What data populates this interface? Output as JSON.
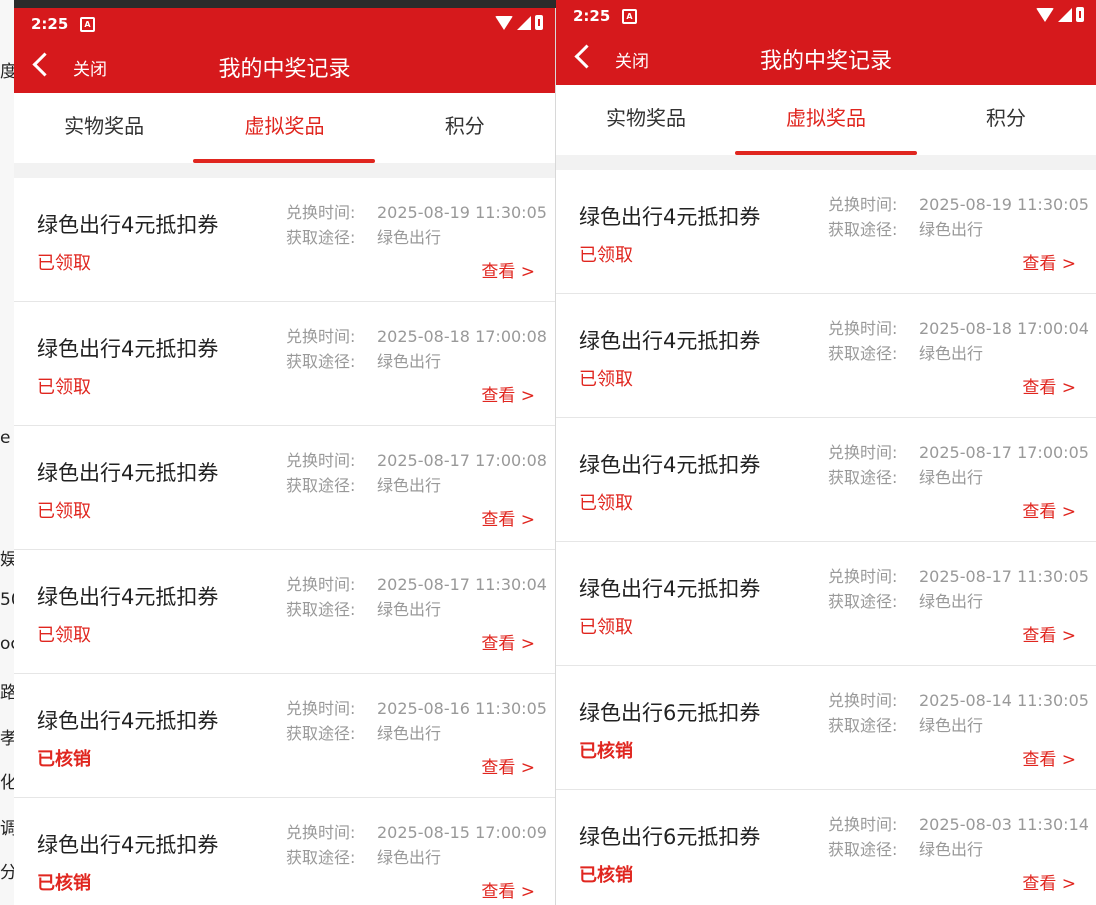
{
  "background_fragments": [
    "度",
    "e C",
    "娱",
    "50",
    "oc",
    "路",
    "孝",
    "化",
    "调",
    "分"
  ],
  "screens": [
    {
      "status": {
        "time": "2:25",
        "notif_icon": "A"
      },
      "nav": {
        "close_label": "关闭",
        "title": "我的中奖记录"
      },
      "tabs": [
        {
          "label": "实物奖品",
          "active": false
        },
        {
          "label": "虚拟奖品",
          "active": true
        },
        {
          "label": "积分",
          "active": false
        }
      ],
      "items": [
        {
          "name": "绿色出行4元抵扣券",
          "status": "已领取",
          "time_label": "兑换时间:",
          "time": "2025-08-19 11:30:05",
          "source_label": "获取途径:",
          "source": "绿色出行",
          "view": "查看 >"
        },
        {
          "name": "绿色出行4元抵扣券",
          "status": "已领取",
          "time_label": "兑换时间:",
          "time": "2025-08-18 17:00:08",
          "source_label": "获取途径:",
          "source": "绿色出行",
          "view": "查看 >"
        },
        {
          "name": "绿色出行4元抵扣券",
          "status": "已领取",
          "time_label": "兑换时间:",
          "time": "2025-08-17 17:00:08",
          "source_label": "获取途径:",
          "source": "绿色出行",
          "view": "查看 >"
        },
        {
          "name": "绿色出行4元抵扣券",
          "status": "已领取",
          "time_label": "兑换时间:",
          "time": "2025-08-17 11:30:04",
          "source_label": "获取途径:",
          "source": "绿色出行",
          "view": "查看 >"
        },
        {
          "name": "绿色出行4元抵扣券",
          "status": "已核销",
          "time_label": "兑换时间:",
          "time": "2025-08-16 11:30:05",
          "source_label": "获取途径:",
          "source": "绿色出行",
          "view": "查看 >"
        },
        {
          "name": "绿色出行4元抵扣券",
          "status": "已核销",
          "time_label": "兑换时间:",
          "time": "2025-08-15 17:00:09",
          "source_label": "获取途径:",
          "source": "绿色出行",
          "view": "查看 >"
        }
      ]
    },
    {
      "status": {
        "time": "2:25",
        "notif_icon": "A"
      },
      "nav": {
        "close_label": "关闭",
        "title": "我的中奖记录"
      },
      "tabs": [
        {
          "label": "实物奖品",
          "active": false
        },
        {
          "label": "虚拟奖品",
          "active": true
        },
        {
          "label": "积分",
          "active": false
        }
      ],
      "items": [
        {
          "name": "绿色出行4元抵扣券",
          "status": "已领取",
          "time_label": "兑换时间:",
          "time": "2025-08-19 11:30:05",
          "source_label": "获取途径:",
          "source": "绿色出行",
          "view": "查看 >"
        },
        {
          "name": "绿色出行4元抵扣券",
          "status": "已领取",
          "time_label": "兑换时间:",
          "time": "2025-08-18 17:00:04",
          "source_label": "获取途径:",
          "source": "绿色出行",
          "view": "查看 >"
        },
        {
          "name": "绿色出行4元抵扣券",
          "status": "已领取",
          "time_label": "兑换时间:",
          "time": "2025-08-17 17:00:05",
          "source_label": "获取途径:",
          "source": "绿色出行",
          "view": "查看 >"
        },
        {
          "name": "绿色出行4元抵扣券",
          "status": "已领取",
          "time_label": "兑换时间:",
          "time": "2025-08-17 11:30:05",
          "source_label": "获取途径:",
          "source": "绿色出行",
          "view": "查看 >"
        },
        {
          "name": "绿色出行6元抵扣券",
          "status": "已核销",
          "time_label": "兑换时间:",
          "time": "2025-08-14 11:30:05",
          "source_label": "获取途径:",
          "source": "绿色出行",
          "view": "查看 >"
        },
        {
          "name": "绿色出行6元抵扣券",
          "status": "已核销",
          "time_label": "兑换时间:",
          "time": "2025-08-03 11:30:14",
          "source_label": "获取途径:",
          "source": "绿色出行",
          "view": "查看 >"
        }
      ]
    }
  ],
  "colors": {
    "brand_red": "#d6191c",
    "accent_red": "#e0261f",
    "muted_text": "#999999"
  }
}
